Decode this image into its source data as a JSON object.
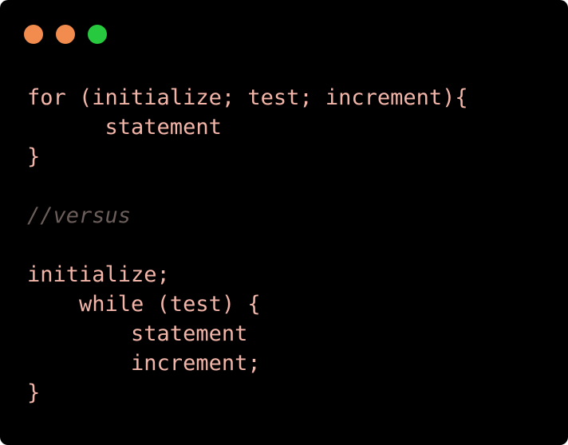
{
  "window": {
    "controls": [
      {
        "name": "close-control",
        "color": "#f28c4e"
      },
      {
        "name": "minimize-control",
        "color": "#f28c4e"
      },
      {
        "name": "zoom-control",
        "color": "#27c93f"
      }
    ]
  },
  "code": {
    "text_color": "#f2b5a8",
    "comment_color": "#6b5e5a",
    "lines": [
      "for (initialize; test; increment){",
      "      statement",
      "}",
      "",
      "//versus",
      "",
      "initialize;",
      "    while (test) {",
      "        statement",
      "        increment;",
      "}"
    ]
  }
}
